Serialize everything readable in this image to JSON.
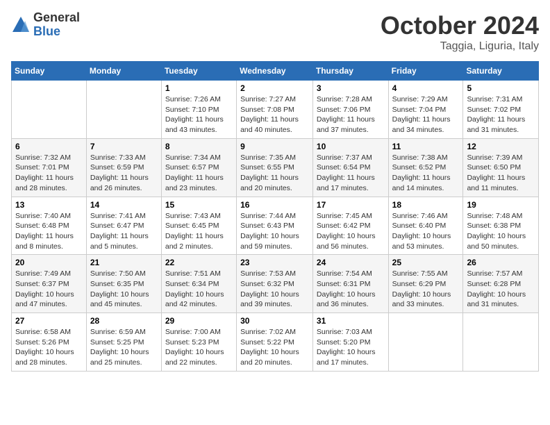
{
  "header": {
    "logo_general": "General",
    "logo_blue": "Blue",
    "title": "October 2024",
    "location": "Taggia, Liguria, Italy"
  },
  "weekdays": [
    "Sunday",
    "Monday",
    "Tuesday",
    "Wednesday",
    "Thursday",
    "Friday",
    "Saturday"
  ],
  "weeks": [
    [
      {
        "day": "",
        "content": ""
      },
      {
        "day": "",
        "content": ""
      },
      {
        "day": "1",
        "content": "Sunrise: 7:26 AM\nSunset: 7:10 PM\nDaylight: 11 hours and 43 minutes."
      },
      {
        "day": "2",
        "content": "Sunrise: 7:27 AM\nSunset: 7:08 PM\nDaylight: 11 hours and 40 minutes."
      },
      {
        "day": "3",
        "content": "Sunrise: 7:28 AM\nSunset: 7:06 PM\nDaylight: 11 hours and 37 minutes."
      },
      {
        "day": "4",
        "content": "Sunrise: 7:29 AM\nSunset: 7:04 PM\nDaylight: 11 hours and 34 minutes."
      },
      {
        "day": "5",
        "content": "Sunrise: 7:31 AM\nSunset: 7:02 PM\nDaylight: 11 hours and 31 minutes."
      }
    ],
    [
      {
        "day": "6",
        "content": "Sunrise: 7:32 AM\nSunset: 7:01 PM\nDaylight: 11 hours and 28 minutes."
      },
      {
        "day": "7",
        "content": "Sunrise: 7:33 AM\nSunset: 6:59 PM\nDaylight: 11 hours and 26 minutes."
      },
      {
        "day": "8",
        "content": "Sunrise: 7:34 AM\nSunset: 6:57 PM\nDaylight: 11 hours and 23 minutes."
      },
      {
        "day": "9",
        "content": "Sunrise: 7:35 AM\nSunset: 6:55 PM\nDaylight: 11 hours and 20 minutes."
      },
      {
        "day": "10",
        "content": "Sunrise: 7:37 AM\nSunset: 6:54 PM\nDaylight: 11 hours and 17 minutes."
      },
      {
        "day": "11",
        "content": "Sunrise: 7:38 AM\nSunset: 6:52 PM\nDaylight: 11 hours and 14 minutes."
      },
      {
        "day": "12",
        "content": "Sunrise: 7:39 AM\nSunset: 6:50 PM\nDaylight: 11 hours and 11 minutes."
      }
    ],
    [
      {
        "day": "13",
        "content": "Sunrise: 7:40 AM\nSunset: 6:48 PM\nDaylight: 11 hours and 8 minutes."
      },
      {
        "day": "14",
        "content": "Sunrise: 7:41 AM\nSunset: 6:47 PM\nDaylight: 11 hours and 5 minutes."
      },
      {
        "day": "15",
        "content": "Sunrise: 7:43 AM\nSunset: 6:45 PM\nDaylight: 11 hours and 2 minutes."
      },
      {
        "day": "16",
        "content": "Sunrise: 7:44 AM\nSunset: 6:43 PM\nDaylight: 10 hours and 59 minutes."
      },
      {
        "day": "17",
        "content": "Sunrise: 7:45 AM\nSunset: 6:42 PM\nDaylight: 10 hours and 56 minutes."
      },
      {
        "day": "18",
        "content": "Sunrise: 7:46 AM\nSunset: 6:40 PM\nDaylight: 10 hours and 53 minutes."
      },
      {
        "day": "19",
        "content": "Sunrise: 7:48 AM\nSunset: 6:38 PM\nDaylight: 10 hours and 50 minutes."
      }
    ],
    [
      {
        "day": "20",
        "content": "Sunrise: 7:49 AM\nSunset: 6:37 PM\nDaylight: 10 hours and 47 minutes."
      },
      {
        "day": "21",
        "content": "Sunrise: 7:50 AM\nSunset: 6:35 PM\nDaylight: 10 hours and 45 minutes."
      },
      {
        "day": "22",
        "content": "Sunrise: 7:51 AM\nSunset: 6:34 PM\nDaylight: 10 hours and 42 minutes."
      },
      {
        "day": "23",
        "content": "Sunrise: 7:53 AM\nSunset: 6:32 PM\nDaylight: 10 hours and 39 minutes."
      },
      {
        "day": "24",
        "content": "Sunrise: 7:54 AM\nSunset: 6:31 PM\nDaylight: 10 hours and 36 minutes."
      },
      {
        "day": "25",
        "content": "Sunrise: 7:55 AM\nSunset: 6:29 PM\nDaylight: 10 hours and 33 minutes."
      },
      {
        "day": "26",
        "content": "Sunrise: 7:57 AM\nSunset: 6:28 PM\nDaylight: 10 hours and 31 minutes."
      }
    ],
    [
      {
        "day": "27",
        "content": "Sunrise: 6:58 AM\nSunset: 5:26 PM\nDaylight: 10 hours and 28 minutes."
      },
      {
        "day": "28",
        "content": "Sunrise: 6:59 AM\nSunset: 5:25 PM\nDaylight: 10 hours and 25 minutes."
      },
      {
        "day": "29",
        "content": "Sunrise: 7:00 AM\nSunset: 5:23 PM\nDaylight: 10 hours and 22 minutes."
      },
      {
        "day": "30",
        "content": "Sunrise: 7:02 AM\nSunset: 5:22 PM\nDaylight: 10 hours and 20 minutes."
      },
      {
        "day": "31",
        "content": "Sunrise: 7:03 AM\nSunset: 5:20 PM\nDaylight: 10 hours and 17 minutes."
      },
      {
        "day": "",
        "content": ""
      },
      {
        "day": "",
        "content": ""
      }
    ]
  ]
}
